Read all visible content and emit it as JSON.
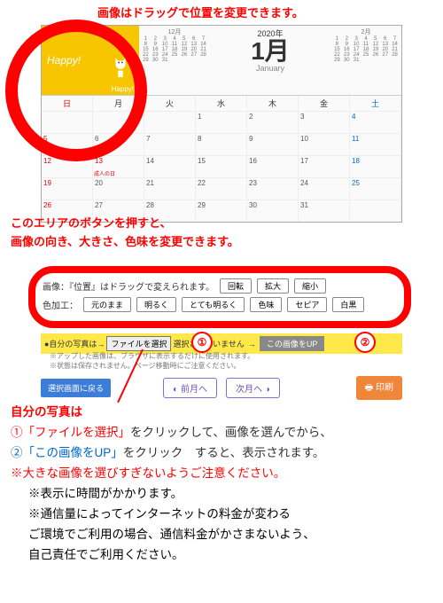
{
  "top_note": "画像はドラッグで位置を変更できます。",
  "photo": {
    "happy": "Happy!",
    "caption": "Happy!"
  },
  "mini_prev": {
    "title": "12月"
  },
  "mini_next": {
    "title": "2月"
  },
  "main": {
    "year": "2020年",
    "month": "1月",
    "en": "January"
  },
  "dow": [
    "日",
    "月",
    "火",
    "水",
    "木",
    "金",
    "土"
  ],
  "holiday": "成人の日",
  "mid_note1": "このエリアのボタンを押すと、",
  "mid_note2": "画像の向き、大きさ、色味を変更できます。",
  "ctrl": {
    "row1_label": "画像：『位置』はドラッグで変えられます。",
    "rotate": "回転",
    "zoom_in": "拡大",
    "zoom_out": "縮小",
    "row2_label": "色加工：",
    "orig": "元のまま",
    "bright": "明るく",
    "vbright": "とても明るく",
    "hue": "色味",
    "sepia": "セピア",
    "bw": "白黒"
  },
  "upload": {
    "lead": "●自分の写真は→",
    "file_btn": "ファイルを選択",
    "file_status": "選択されていません",
    "arrow": "→",
    "up_btn": "この画像をUP"
  },
  "small_notes": {
    "a": "※アップした画像は、ブラウザに表示するだけに使用されます。",
    "b": "※状態は保存されません。ページ移動時にご注意ください。"
  },
  "nav": {
    "back": "選択画面に戻る",
    "prev": "前月へ",
    "next": "次月へ",
    "print": "印刷"
  },
  "body": {
    "hd": "自分の写真は",
    "l1a": "①",
    "l1b": "「ファイルを選択」",
    "l1c": "をクリックして、画像を選んでから、",
    "l2a": "②",
    "l2b": "「この画像をUP」",
    "l2c": "をクリック　すると、表示されます。",
    "warn": "※大きな画像を選びすぎないようご注意ください。",
    "s1": "※表示に時間がかかります。",
    "s2": "※通信量によってインターネットの料金が変わる",
    "s3": "ご環境でご利用の場合、通信料金がかさまないよう、",
    "s4": "自己責任でご利用ください。"
  }
}
